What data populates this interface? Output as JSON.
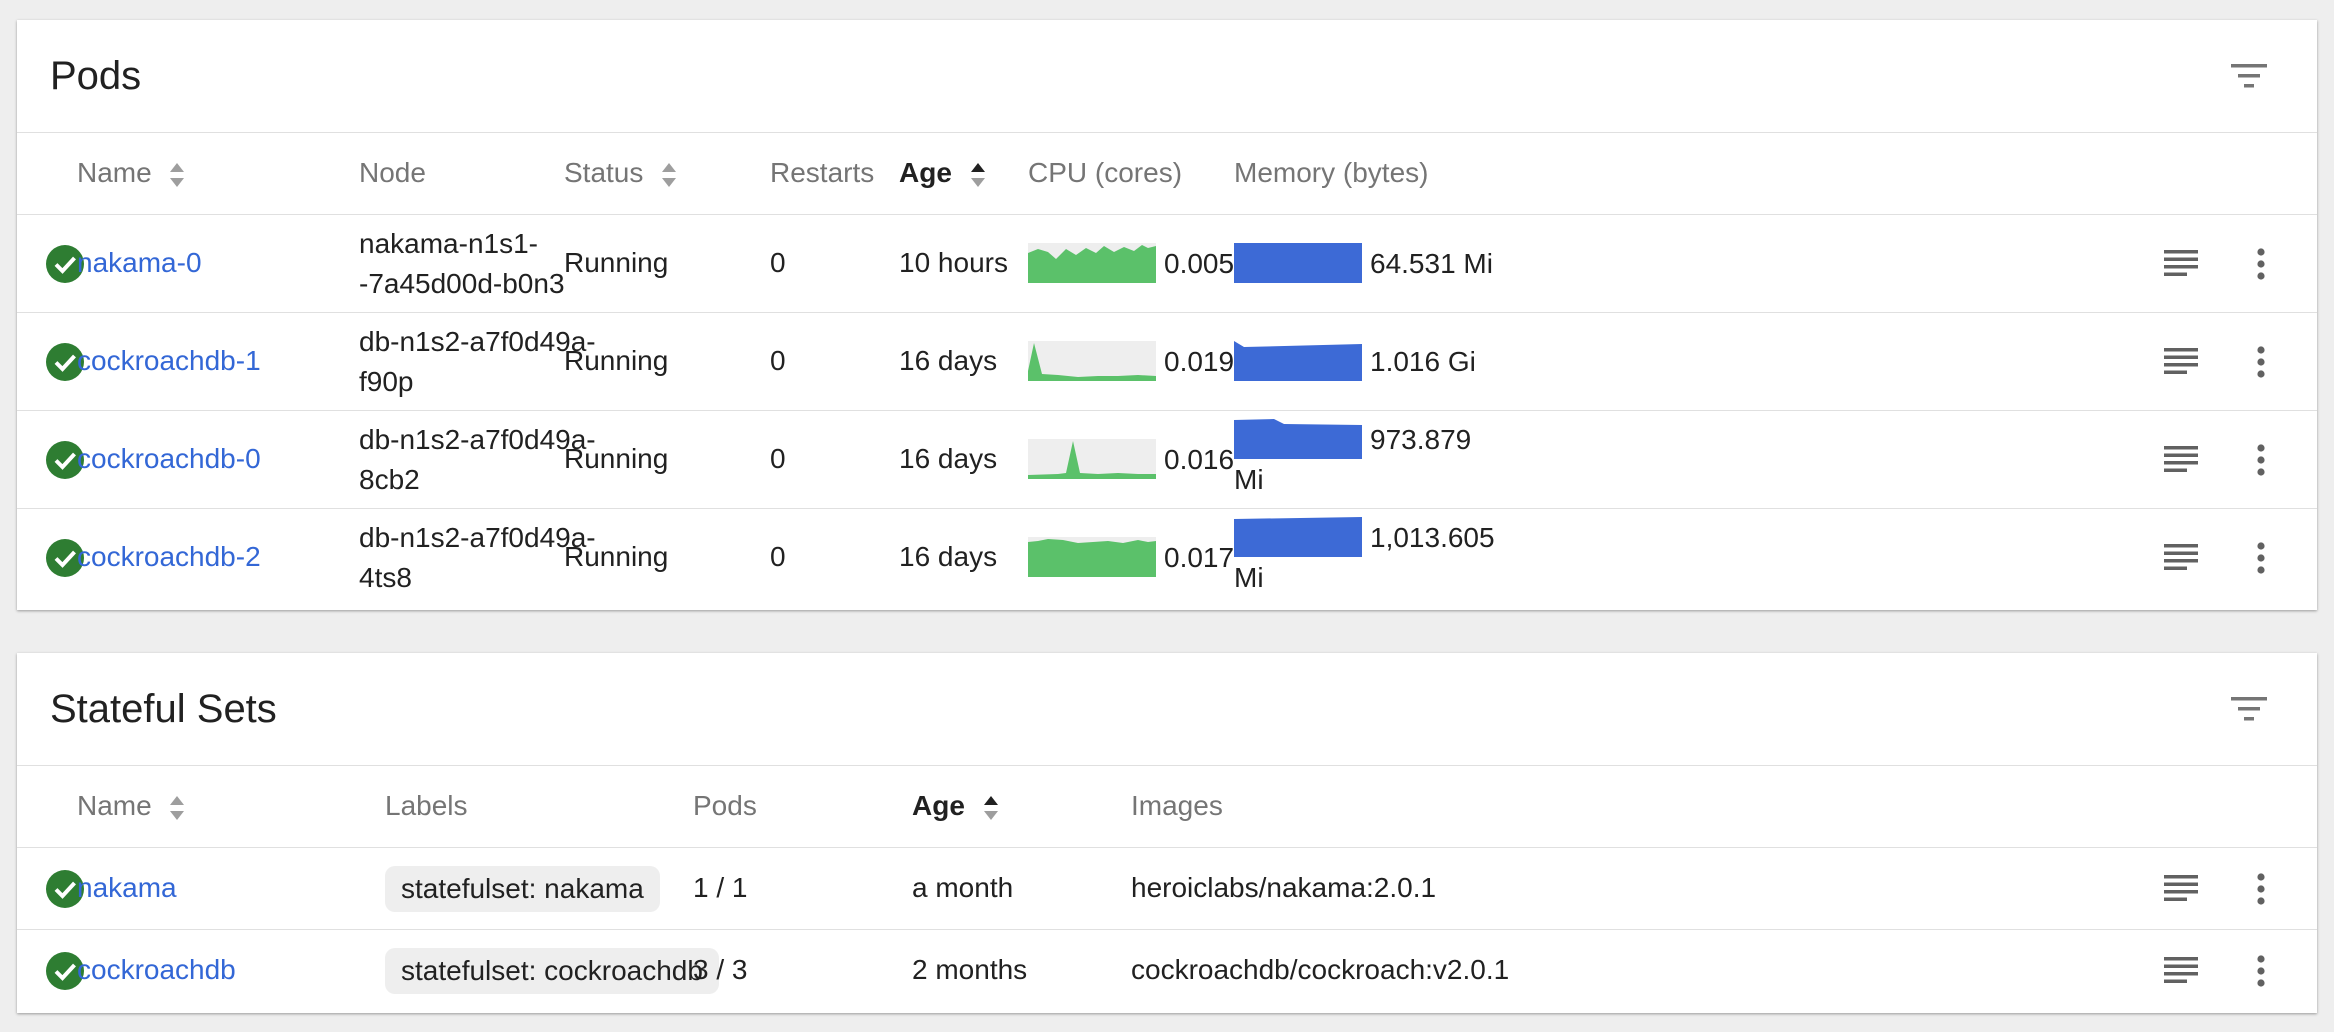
{
  "colors": {
    "link": "#3367d6",
    "success": "#2e7d32",
    "cpu": "#5bc16a",
    "memory": "#3d6ad6"
  },
  "pods": {
    "title": "Pods",
    "headers": {
      "name": "Name",
      "node": "Node",
      "status": "Status",
      "restarts": "Restarts",
      "age": "Age",
      "cpu": "CPU (cores)",
      "memory": "Memory (bytes)"
    },
    "rows": [
      {
        "name": "nakama-0",
        "node": "nakama-n1s1--7a45d00d-b0n3",
        "node_l1": "nakama-n1s1-",
        "node_l2": "-7a45d00d-b0n3",
        "status": "Running",
        "restarts": "0",
        "age": "10 hours",
        "cpu": "0.005",
        "memory": "64.531 Mi",
        "mem_l1": "64.531 Mi",
        "mem_l2": ""
      },
      {
        "name": "cockroachdb-1",
        "node": "db-n1s2-a7f0d49a-f90p",
        "node_l1": "db-n1s2-a7f0d49a-",
        "node_l2": "f90p",
        "status": "Running",
        "restarts": "0",
        "age": "16 days",
        "cpu": "0.019",
        "memory": "1.016 Gi",
        "mem_l1": "1.016 Gi",
        "mem_l2": ""
      },
      {
        "name": "cockroachdb-0",
        "node": "db-n1s2-a7f0d49a-8cb2",
        "node_l1": "db-n1s2-a7f0d49a-",
        "node_l2": "8cb2",
        "status": "Running",
        "restarts": "0",
        "age": "16 days",
        "cpu": "0.016",
        "memory": "973.879 Mi",
        "mem_l1": "973.879",
        "mem_l2": "Mi"
      },
      {
        "name": "cockroachdb-2",
        "node": "db-n1s2-a7f0d49a-4ts8",
        "node_l1": "db-n1s2-a7f0d49a-",
        "node_l2": "4ts8",
        "status": "Running",
        "restarts": "0",
        "age": "16 days",
        "cpu": "0.017",
        "memory": "1,013.605 Mi",
        "mem_l1": "1,013.605",
        "mem_l2": "Mi"
      }
    ]
  },
  "stateful_sets": {
    "title": "Stateful Sets",
    "headers": {
      "name": "Name",
      "labels": "Labels",
      "pods": "Pods",
      "age": "Age",
      "images": "Images"
    },
    "rows": [
      {
        "name": "nakama",
        "label": "statefulset: nakama",
        "pods": "1 / 1",
        "age": "a month",
        "image": "heroiclabs/nakama:2.0.1"
      },
      {
        "name": "cockroachdb",
        "label": "statefulset: cockroachdb",
        "pods": "3 / 3",
        "age": "2 months",
        "image": "cockroachdb/cockroach:v2.0.1"
      }
    ]
  },
  "icons": {
    "filter": "filter-icon",
    "status": "check-circle-icon",
    "logs": "logs-icon",
    "more": "more-vert-icon",
    "sort": "sort-arrows-icon"
  }
}
